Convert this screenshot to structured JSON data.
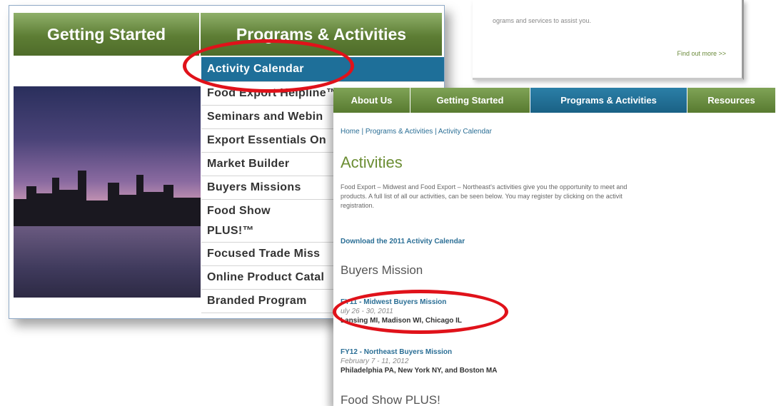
{
  "back_panel": {
    "text": "ograms and services to assist you.",
    "link": "Find out more >>"
  },
  "left_panel": {
    "tabs": [
      "Getting Started",
      "Programs & Activities"
    ],
    "menu": [
      "Activity Calendar",
      "Food Export Helpline™",
      "Seminars and Webin",
      "Export Essentials On",
      "Market Builder",
      "Buyers Missions",
      "Food Show",
      "PLUS!™",
      "Focused Trade Miss",
      "Online Product Catal",
      "Branded Program"
    ]
  },
  "front_panel": {
    "tabs": [
      "About Us",
      "Getting Started",
      "Programs & Activities",
      "Resources"
    ],
    "breadcrumb": "Home | Programs & Activities | Activity Calendar",
    "heading": "Activities",
    "intro_line1": "Food Export – Midwest and Food Export – Northeast's activities give you the opportunity to meet and",
    "intro_line2": "products. A full list of all our activities, can be seen below. You may register by clicking on the activit",
    "intro_line3": "registration.",
    "download_link": "Download the 2011 Activity Calendar",
    "section_heading": "Buyers Mission",
    "missions": [
      {
        "title": "FY11 - Midwest Buyers Mission",
        "date": "uly 26 - 30, 2011",
        "location": "Lansing MI, Madison WI, Chicago IL"
      },
      {
        "title": "FY12 - Northeast Buyers Mission",
        "date": "February 7 - 11, 2012",
        "location": "Philadelphia PA, New York NY, and Boston MA"
      }
    ],
    "next_heading": "Food Show PLUS!"
  },
  "colors": {
    "nav_green": "#5d7d34",
    "active_blue": "#1e6f99",
    "highlight_red": "#e0121a",
    "link_blue": "#2a6e95",
    "heading_green": "#6c8e34"
  }
}
